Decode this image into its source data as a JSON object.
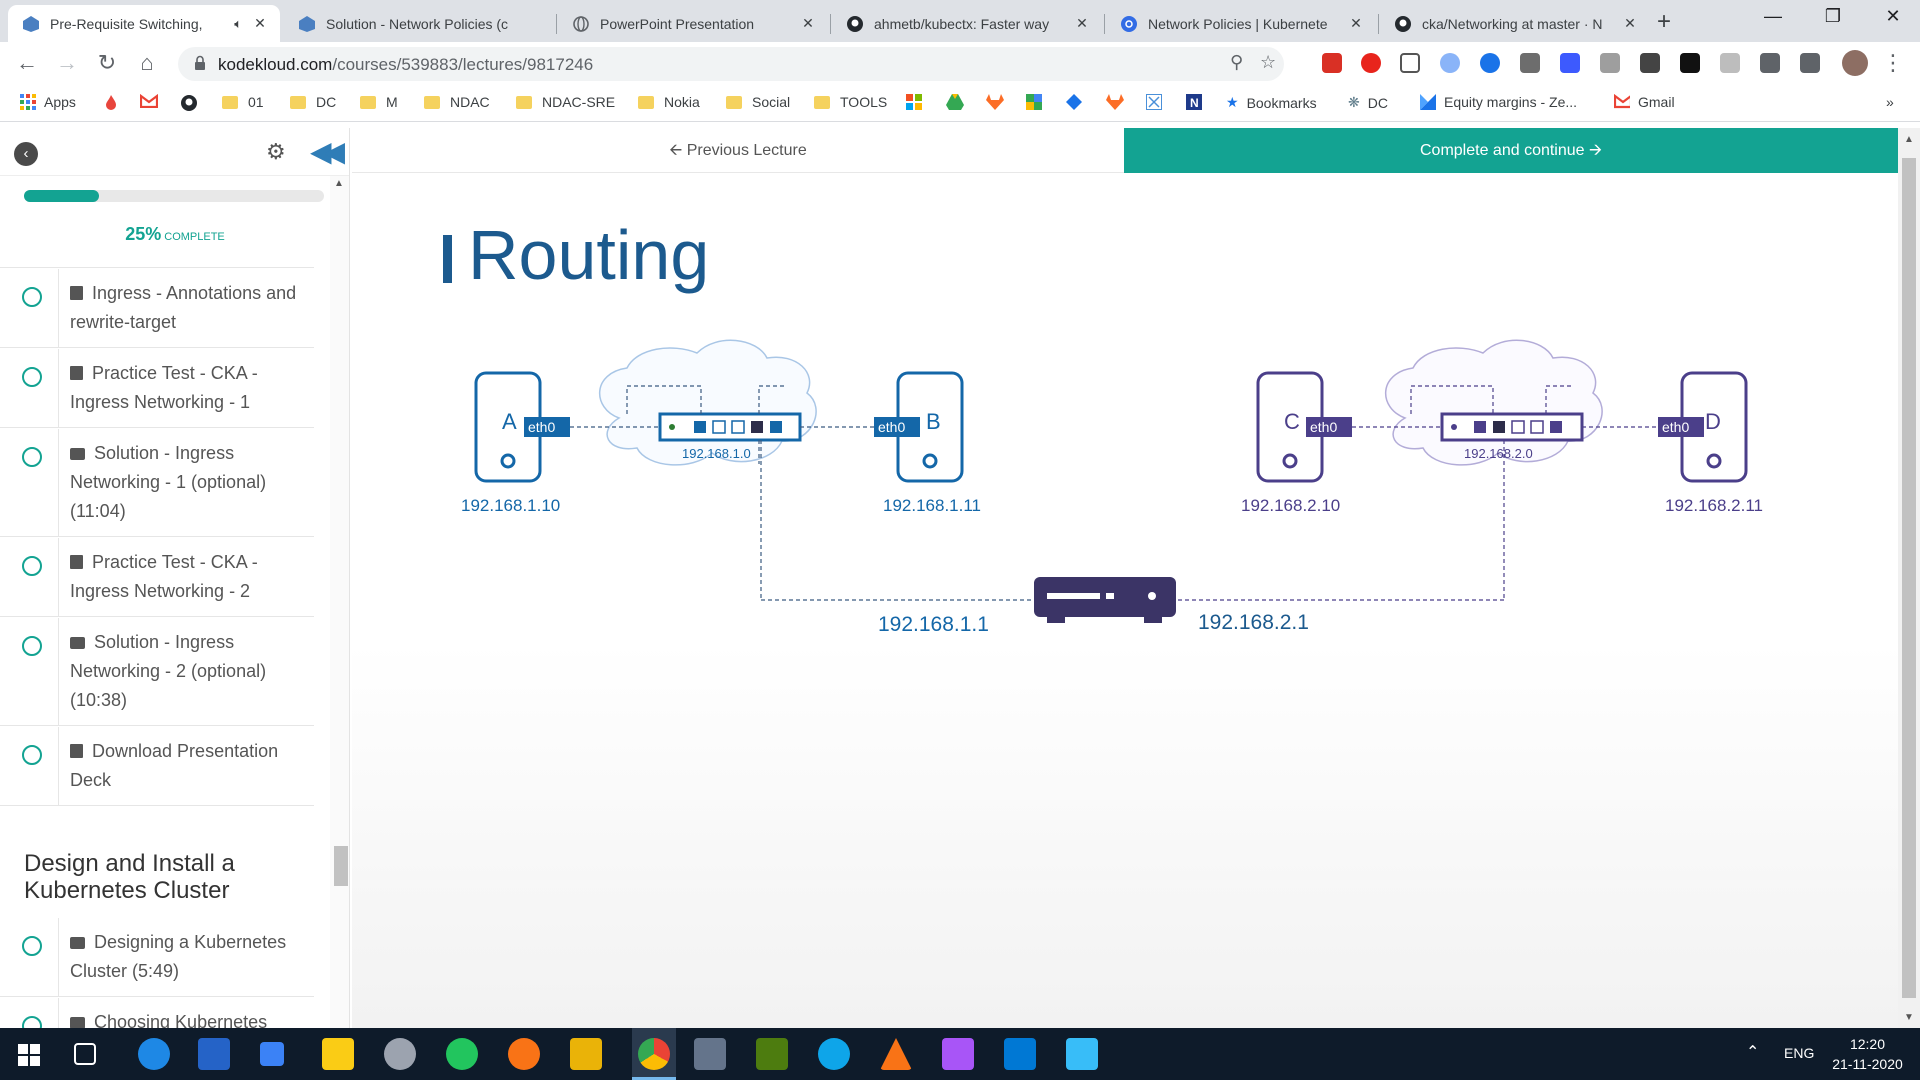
{
  "browser": {
    "tabs": [
      {
        "title": "Pre-Requisite Switching,",
        "active": true,
        "muted": true
      },
      {
        "title": "Solution - Network Policies (c"
      },
      {
        "title": "PowerPoint Presentation"
      },
      {
        "title": "ahmetb/kubectx: Faster way"
      },
      {
        "title": "Network Policies | Kubernete"
      },
      {
        "title": "cka/Networking at master · N"
      }
    ],
    "url_host": "kodekloud.com",
    "url_path": "/courses/539883/lectures/9817246",
    "bookmarks": [
      "Apps",
      "01",
      "DC",
      "M",
      "NDAC",
      "NDAC-SRE",
      "Nokia",
      "Social",
      "TOOLS",
      "Bookmarks",
      "DC",
      "Equity margins - Ze...",
      "Gmail"
    ]
  },
  "sidebar": {
    "progress_percent": "25%",
    "progress_label": "COMPLETE",
    "progress_value": 0.25,
    "lessons": [
      {
        "title": "Ingress - Annotations and rewrite-target",
        "kind": "doc"
      },
      {
        "title": "Practice Test - CKA - Ingress Networking - 1",
        "kind": "doc"
      },
      {
        "title": "Solution - Ingress Networking - 1 (optional) (11:04)",
        "kind": "video"
      },
      {
        "title": "Practice Test - CKA - Ingress Networking - 2",
        "kind": "doc"
      },
      {
        "title": "Solution - Ingress Networking - 2 (optional) (10:38)",
        "kind": "video"
      },
      {
        "title": "Download Presentation Deck",
        "kind": "doc"
      }
    ],
    "section_title": "Design and Install a Kubernetes Cluster",
    "section_lessons": [
      {
        "title": "Designing a Kubernetes Cluster (5:49)",
        "kind": "video"
      },
      {
        "title": "Choosing Kubernetes",
        "kind": "video"
      }
    ]
  },
  "lecture_nav": {
    "previous": "Previous Lecture",
    "complete": "Complete and continue"
  },
  "slide": {
    "title": "Routing",
    "hosts": [
      {
        "label": "A",
        "iface": "eth0",
        "ip": "192.168.1.10"
      },
      {
        "label": "B",
        "iface": "eth0",
        "ip": "192.168.1.11"
      },
      {
        "label": "C",
        "iface": "eth0",
        "ip": "192.168.2.10"
      },
      {
        "label": "D",
        "iface": "eth0",
        "ip": "192.168.2.11"
      }
    ],
    "switches": [
      {
        "network": "192.168.1.0"
      },
      {
        "network": "192.168.2.0"
      }
    ],
    "router": {
      "left_ip": "192.168.1.1",
      "right_ip": "192.168.2.1"
    },
    "colors": {
      "blue": "#1467a8",
      "purple": "#4b3f8a",
      "title": "#1c5a8e"
    }
  },
  "taskbar": {
    "language": "ENG",
    "time": "12:20",
    "date": "21-11-2020"
  },
  "colors": {
    "accent": "#13a392",
    "progress_track": "#e8e8e8"
  }
}
